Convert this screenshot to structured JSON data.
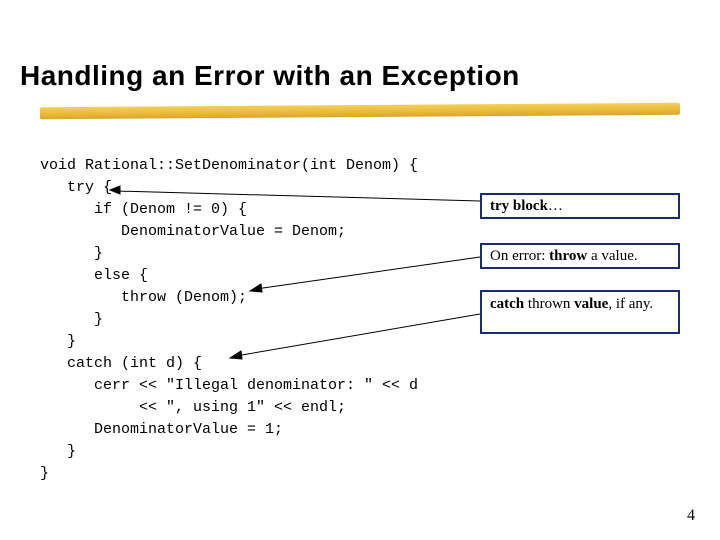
{
  "title": "Handling an Error with an Exception",
  "code": "void Rational::SetDenominator(int Denom) {\n   try {\n      if (Denom != 0) {\n         DenominatorValue = Denom;\n      }\n      else {\n         throw (Denom);\n      }\n   }\n   catch (int d) {\n      cerr << \"Illegal denominator: \" << d\n           << \", using 1\" << endl;\n      DenominatorValue = 1;\n   }\n}",
  "annot": {
    "tryblock_pre": "try block",
    "tryblock_suf": "…",
    "onerror_pre": "On error: ",
    "onerror_bold": "throw",
    "onerror_suf": " a value.",
    "catch_bold1": "catch",
    "catch_mid": " thrown ",
    "catch_bold2": "value",
    "catch_suf": ", if any."
  },
  "page_number": "4"
}
